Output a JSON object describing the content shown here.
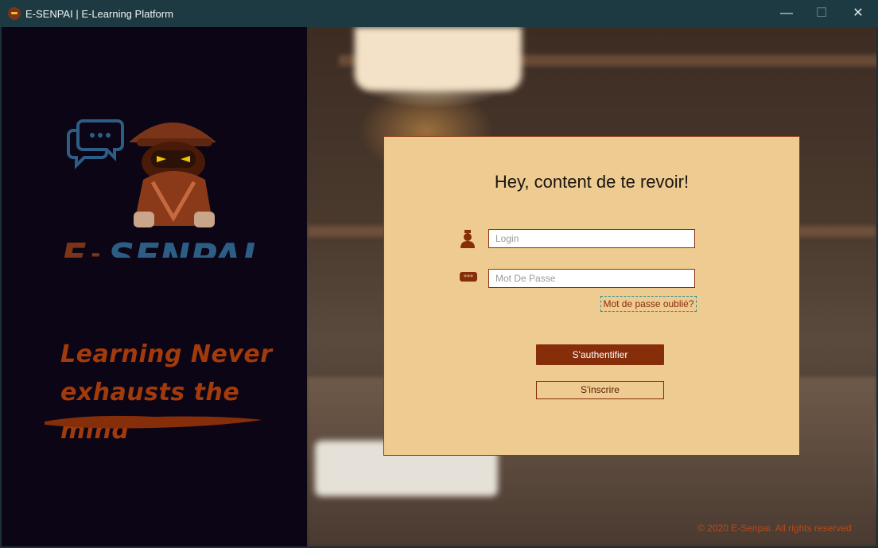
{
  "window": {
    "title": "E-SENPAI | E-Learning Platform",
    "controls": {
      "minimize": "—",
      "maximize": "☐",
      "close": "✕"
    }
  },
  "sidebar": {
    "logo_text_left": "E",
    "logo_text_dash": "-",
    "logo_text_right": "SENPAI",
    "tagline": [
      "Learning Never",
      "exhausts the mind"
    ]
  },
  "login": {
    "heading": "Hey, content de te revoir!",
    "login_placeholder": "Login",
    "login_value": "",
    "password_placeholder": "Mot De Passe",
    "password_value": "",
    "forgot_label": "Mot de passe oublié?",
    "submit_label": "S'authentifier",
    "register_label": "S'inscrire"
  },
  "footer": {
    "copyright": "© 2020 E-Senpai. All rights reserved"
  },
  "colors": {
    "titlebar": "#1d3a42",
    "sidebar": "#0b0515",
    "card": "#eecc91",
    "accent": "#862d09",
    "logo_blue": "#2c5d85",
    "logo_brown": "#7a3518"
  }
}
